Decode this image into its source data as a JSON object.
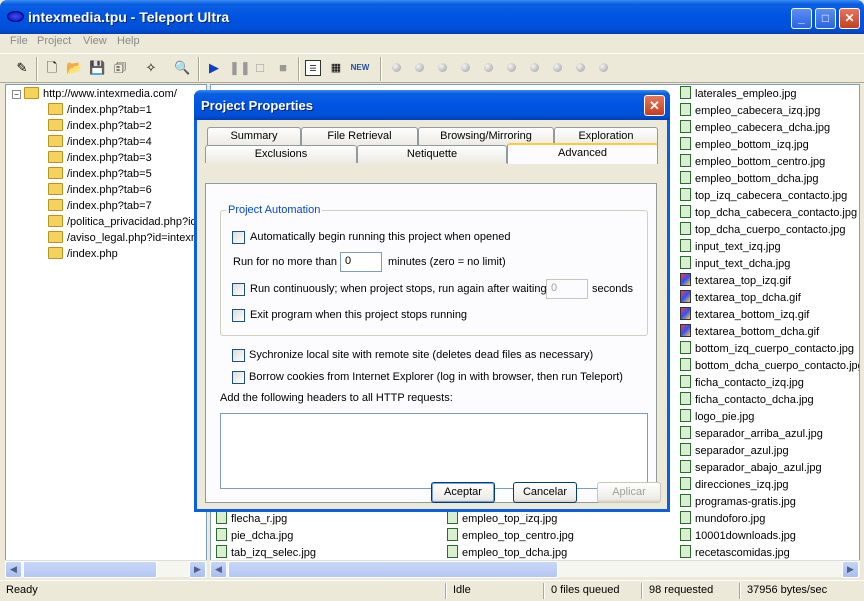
{
  "window": {
    "title": "intexmedia.tpu - Teleport Ultra"
  },
  "menu": [
    "File",
    "Project",
    "View",
    "Help"
  ],
  "toolbar": {
    "new_label": "NEW"
  },
  "tree": {
    "root": "http://www.intexmedia.com/",
    "items": [
      "/index.php?tab=1",
      "/index.php?tab=2",
      "/index.php?tab=4",
      "/index.php?tab=3",
      "/index.php?tab=5",
      "/index.php?tab=6",
      "/index.php?tab=7",
      "/politica_privacidad.php?id",
      "/aviso_legal.php?id=intexm",
      "/index.php"
    ]
  },
  "files_right": [
    {
      "name": "laterales_empleo.jpg",
      "type": "jpg"
    },
    {
      "name": "empleo_cabecera_izq.jpg",
      "type": "jpg"
    },
    {
      "name": "empleo_cabecera_dcha.jpg",
      "type": "jpg"
    },
    {
      "name": "empleo_bottom_izq.jpg",
      "type": "jpg"
    },
    {
      "name": "empleo_bottom_centro.jpg",
      "type": "jpg"
    },
    {
      "name": "empleo_bottom_dcha.jpg",
      "type": "jpg"
    },
    {
      "name": "top_izq_cabecera_contacto.jpg",
      "type": "jpg"
    },
    {
      "name": "top_dcha_cabecera_contacto.jpg",
      "type": "jpg"
    },
    {
      "name": "top_dcha_cuerpo_contacto.jpg",
      "type": "jpg"
    },
    {
      "name": "input_text_izq.jpg",
      "type": "jpg"
    },
    {
      "name": "input_text_dcha.jpg",
      "type": "jpg"
    },
    {
      "name": "textarea_top_izq.gif",
      "type": "gif"
    },
    {
      "name": "textarea_top_dcha.gif",
      "type": "gif"
    },
    {
      "name": "textarea_bottom_izq.gif",
      "type": "gif"
    },
    {
      "name": "textarea_bottom_dcha.gif",
      "type": "gif"
    },
    {
      "name": "bottom_izq_cuerpo_contacto.jpg",
      "type": "jpg"
    },
    {
      "name": "bottom_dcha_cuerpo_contacto.jpg",
      "type": "jpg"
    },
    {
      "name": "ficha_contacto_izq.jpg",
      "type": "jpg"
    },
    {
      "name": "ficha_contacto_dcha.jpg",
      "type": "jpg"
    },
    {
      "name": "logo_pie.jpg",
      "type": "jpg"
    },
    {
      "name": "separador_arriba_azul.jpg",
      "type": "jpg"
    },
    {
      "name": "separador_azul.jpg",
      "type": "jpg"
    },
    {
      "name": "separador_abajo_azul.jpg",
      "type": "jpg"
    },
    {
      "name": "direcciones_izq.jpg",
      "type": "jpg"
    },
    {
      "name": "programas-gratis.jpg",
      "type": "jpg"
    },
    {
      "name": "mundoforo.jpg",
      "type": "jpg"
    },
    {
      "name": "10001downloads.jpg",
      "type": "jpg"
    },
    {
      "name": "recetascomidas.jpg",
      "type": "jpg"
    }
  ],
  "files_col1": [
    "flecha_r.jpg",
    "pie_dcha.jpg",
    "tab_izq_selec.jpg"
  ],
  "files_col2": [
    "empleo_top_izq.jpg",
    "empleo_top_centro.jpg",
    "empleo_top_dcha.jpg"
  ],
  "status": {
    "ready": "Ready",
    "state": "Idle",
    "queued": "0 files queued",
    "requested": "98 requested",
    "rate": "37956 bytes/sec"
  },
  "dialog": {
    "title": "Project Properties",
    "tabs_row1": [
      "Summary",
      "File Retrieval",
      "Browsing/Mirroring",
      "Exploration"
    ],
    "tabs_row2": [
      "Exclusions",
      "Netiquette",
      "Advanced"
    ],
    "group_label": "Project Automation",
    "opt_auto_begin": "Automatically begin running this project when opened",
    "run_for_prefix": "Run for no more than",
    "run_for_value": "0",
    "run_for_suffix": "minutes (zero = no limit)",
    "opt_continuous": "Run continuously; when project stops, run again after waiting",
    "wait_value": "0",
    "wait_suffix": "seconds",
    "opt_exit": "Exit program when this project stops running",
    "opt_sync": "Sychronize local site with remote site (deletes dead files as necessary)",
    "opt_cookies": "Borrow cookies from Internet Explorer (log in with browser, then run Teleport)",
    "headers_label": "Add the following headers to all HTTP requests:",
    "headers_value": "",
    "btn_ok": "Aceptar",
    "btn_cancel": "Cancelar",
    "btn_apply": "Aplicar"
  }
}
